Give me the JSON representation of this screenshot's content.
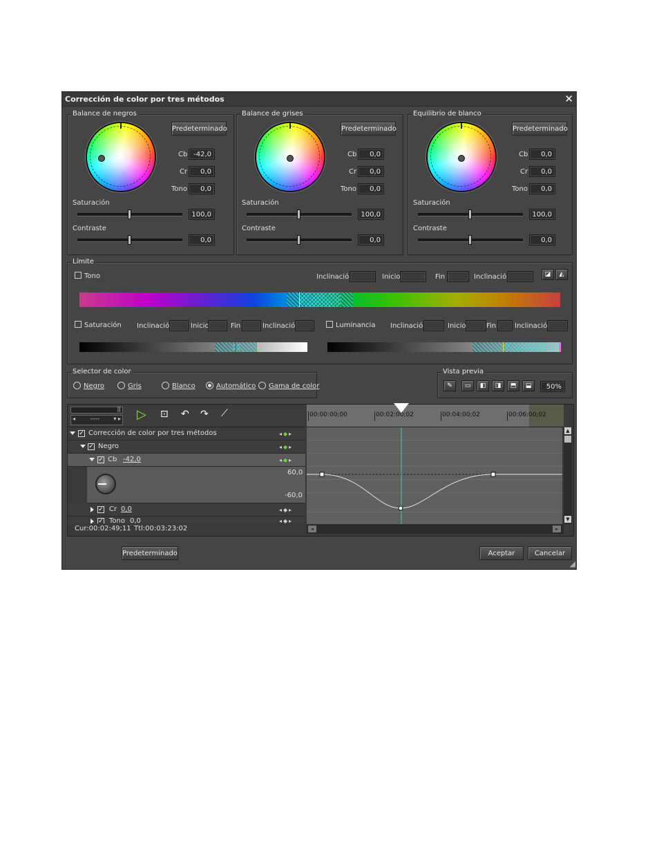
{
  "dialog": {
    "title": "Corrección de color por tres métodos",
    "close_icon": "close-icon"
  },
  "panels": [
    {
      "label": "Balance de negros",
      "default_btn": "Predeterminado",
      "cb_label": "Cb",
      "cb": "-42,0",
      "cr_label": "Cr",
      "cr": "0,0",
      "tone_label": "Tono",
      "tone": "0,0",
      "sat_label": "Saturación",
      "sat": "100,0",
      "con_label": "Contraste",
      "con": "0,0"
    },
    {
      "label": "Balance de grises",
      "default_btn": "Predeterminado",
      "cb_label": "Cb",
      "cb": "0,0",
      "cr_label": "Cr",
      "cr": "0,0",
      "tone_label": "Tono",
      "tone": "0,0",
      "sat_label": "Saturación",
      "sat": "100,0",
      "con_label": "Contraste",
      "con": "0,0"
    },
    {
      "label": "Equilibrio de blanco",
      "default_btn": "Predeterminado",
      "cb_label": "Cb",
      "cb": "0,0",
      "cr_label": "Cr",
      "cr": "0,0",
      "tone_label": "Tono",
      "tone": "0,0",
      "sat_label": "Saturación",
      "sat": "100,0",
      "con_label": "Contraste",
      "con": "0,0"
    }
  ],
  "limit": {
    "label": "Límite",
    "tone": "Tono",
    "saturation": "Saturación",
    "luminance": "Luminancia",
    "incl": "Inclinación",
    "start": "Inicio",
    "end": "Fin"
  },
  "selector": {
    "label": "Selector de color",
    "options": [
      "Negro",
      "Gris",
      "Blanco",
      "Automático",
      "Gama de color"
    ],
    "selected": "Automático"
  },
  "preview": {
    "label": "Vista previa",
    "zoom": "50%"
  },
  "timeline": {
    "transport_value": "----",
    "ticks": [
      "00:00:00;00",
      "00:02:00;02",
      "00:04:00;02",
      "00:06:00;02"
    ],
    "rows": [
      {
        "label": "Corrección de color por tres métodos"
      },
      {
        "label": "Negro"
      },
      {
        "label": "Cb",
        "value": "-42,0"
      },
      {
        "label": "Cr",
        "value": "0,0"
      },
      {
        "label": "Tono",
        "value": "0,0"
      }
    ],
    "graph_max": "60,0",
    "graph_min": "-60,0",
    "cur": "Cur:00:02:49;11",
    "ttl": "Ttl:00:03:23:02"
  },
  "footer": {
    "default_btn": "Predeterminado",
    "ok": "Aceptar",
    "cancel": "Cancelar"
  }
}
